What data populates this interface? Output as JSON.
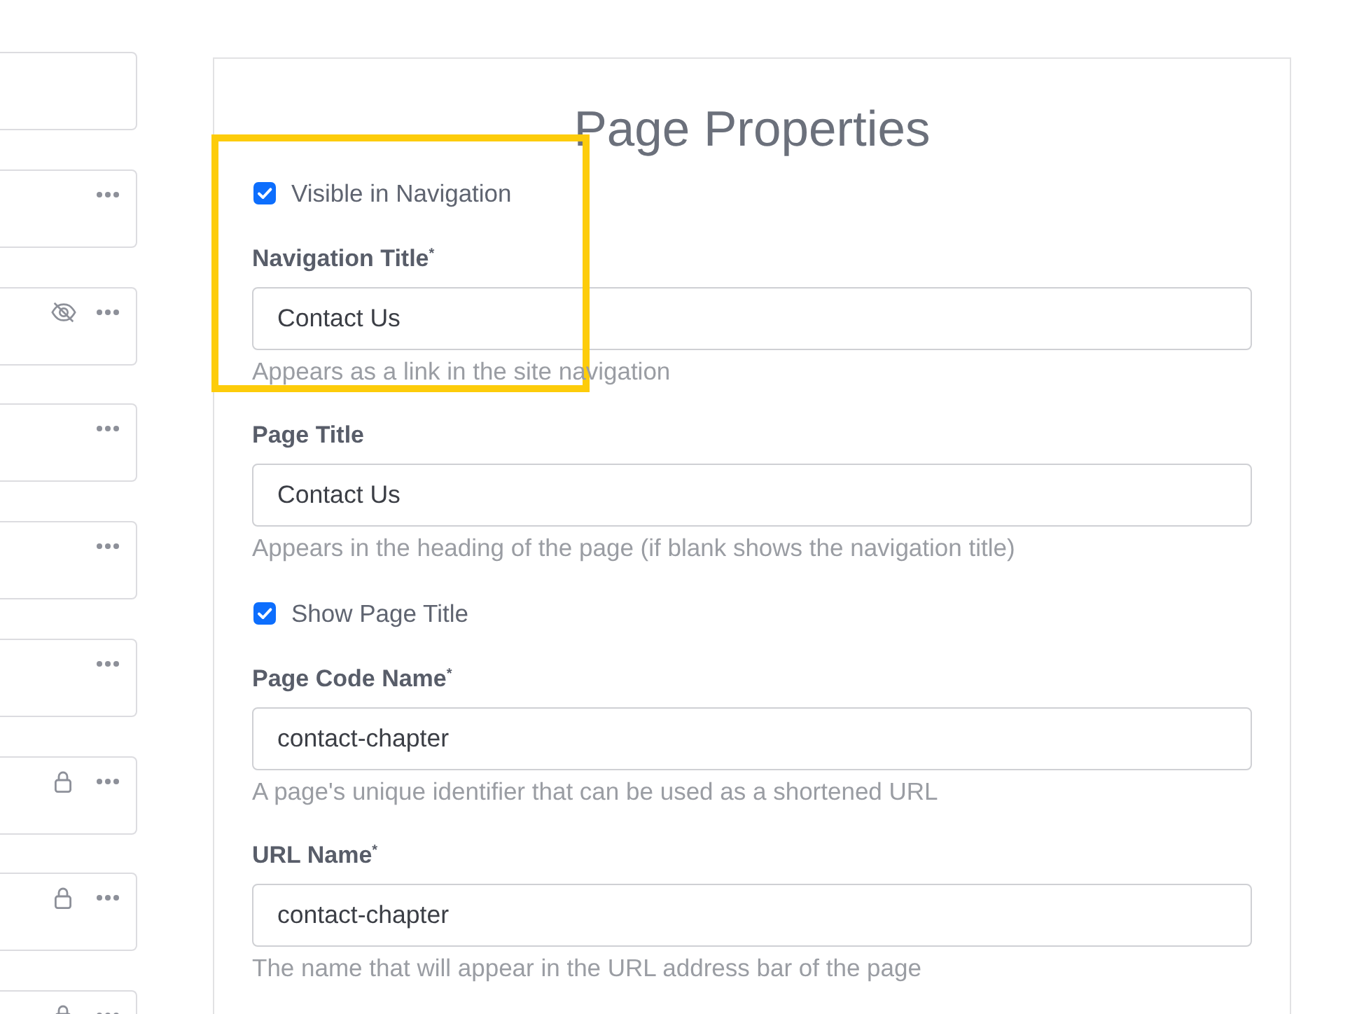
{
  "page_list": [
    {
      "menu": false,
      "hidden": false,
      "locked": false
    },
    {
      "menu": true,
      "hidden": false,
      "locked": false
    },
    {
      "menu": true,
      "hidden": true,
      "locked": false
    },
    {
      "menu": true,
      "hidden": false,
      "locked": false
    },
    {
      "menu": true,
      "hidden": false,
      "locked": false
    },
    {
      "menu": true,
      "hidden": false,
      "locked": false
    },
    {
      "menu": true,
      "hidden": false,
      "locked": true
    },
    {
      "menu": true,
      "hidden": false,
      "locked": true
    },
    {
      "menu": true,
      "hidden": false,
      "locked": true
    }
  ],
  "panel": {
    "title": "Page Properties",
    "fields": [
      {
        "kind": "checkbox",
        "label": "Visible in Navigation",
        "checked": true
      },
      {
        "kind": "text",
        "label": "Navigation Title$^{*}$",
        "value": "Contact Us",
        "help": "Appears as a link in the site navigation"
      },
      {
        "kind": "text",
        "label": "Page Title",
        "value": "Contact Us",
        "help": "Appears in the heading of the page (if blank shows the navigation title)"
      },
      {
        "kind": "checkbox",
        "label": "Show Page Title",
        "checked": true
      },
      {
        "kind": "text",
        "label": "Page Code Name$^{*}$",
        "value": "contact-chapter",
        "help": "A page's unique identifier that can be used as a shortened URL"
      },
      {
        "kind": "text",
        "label": "URL Name$^{*}$",
        "value": "contact-chapter",
        "help": "The name that will appear in the URL address bar of the page"
      }
    ]
  }
}
